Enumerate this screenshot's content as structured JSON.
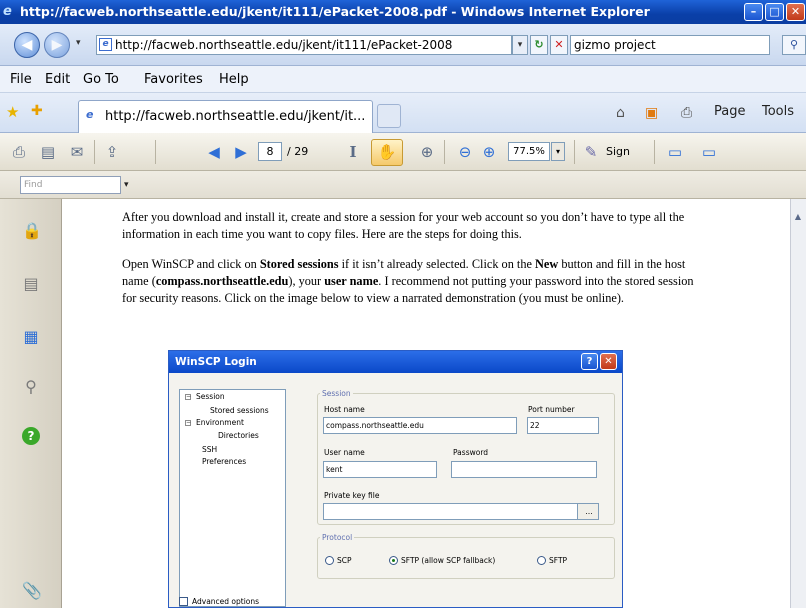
{
  "window": {
    "title": "http://facweb.northseattle.edu/jkent/it111/ePacket-2008.pdf - Windows Internet Explorer",
    "minimize_glyph": "–",
    "maximize_glyph": "□",
    "close_glyph": "✕"
  },
  "address_bar": {
    "url": "http://facweb.northseattle.edu/jkent/it111/ePacket-2008",
    "back_glyph": "◀",
    "forward_glyph": "▶",
    "dropdown_glyph": "▾",
    "refresh_glyph": "↻",
    "stop_glyph": "✕"
  },
  "search": {
    "value": "gizmo project",
    "search_glyph": "⚲"
  },
  "menu": {
    "items": [
      "File",
      "Edit",
      "Go To",
      "Favorites",
      "Help"
    ]
  },
  "tabs": {
    "active_title": "http://facweb.northseattle.edu/jkent/it...",
    "star_glyph": "★",
    "add_fav_glyph": "✚"
  },
  "command_bar": {
    "home_glyph": "⌂",
    "feeds_glyph": "▣",
    "print_glyph": "⎙",
    "page_label": "Page",
    "tools_label": "Tools"
  },
  "pdf_toolbar": {
    "current_page": "8",
    "page_total": "/ 29",
    "zoom": "77.5%",
    "sign_label": "Sign",
    "icons": {
      "print": "⎙",
      "save": "▤",
      "email": "✉",
      "upload": "⇪",
      "prev": "◀",
      "next": "▶",
      "select": "I",
      "hand": "✋",
      "zoom_in": "⊕",
      "zoom_out": "⊖",
      "sign": "✎",
      "fit": "▭"
    }
  },
  "find_bar": {
    "placeholder": "Find",
    "dropdown_glyph": "▾"
  },
  "nav_panel": {
    "icons": {
      "lock": "🔒",
      "pages": "▤",
      "attachments": "▦",
      "search": "⚲",
      "help": "?",
      "paperclip": "📎"
    }
  },
  "document": {
    "para1": "After you download and install it, create and store a session for your web account so you don’t have to type all the information in each time you want to copy files. Here are the steps for doing this.",
    "para2_a": "Open WinSCP and click on ",
    "para2_b": "Stored sessions",
    "para2_c": " if it isn’t already selected.  Click on the ",
    "para2_d": "New",
    "para2_e": " button and fill in the host name (",
    "para2_f": "compass.northseattle.edu",
    "para2_g": "), your ",
    "para2_h": "user name",
    "para2_i": ". I recommend not putting your password into the stored session for security reasons. Click on the image below to view a narrated demonstration (you must be online)."
  },
  "winscp": {
    "title": "WinSCP Login",
    "help_glyph": "?",
    "close_glyph": "✕",
    "tree": {
      "session": "Session",
      "stored_sessions": "Stored sessions",
      "environment": "Environment",
      "directories": "Directories",
      "ssh": "SSH",
      "preferences": "Preferences"
    },
    "session_group": "Session",
    "host_name_label": "Host name",
    "host_name_value": "compass.northseattle.edu",
    "port_label": "Port number",
    "port_value": "22",
    "user_name_label": "User name",
    "user_name_value": "kent",
    "password_label": "Password",
    "private_key_label": "Private key file",
    "protocol_group": "Protocol",
    "protocol_scp": "SCP",
    "protocol_sftp_fallback": "SFTP (allow SCP fallback)",
    "protocol_sftp": "SFTP",
    "advanced_options": "Advanced options",
    "browse_glyph": "…"
  }
}
